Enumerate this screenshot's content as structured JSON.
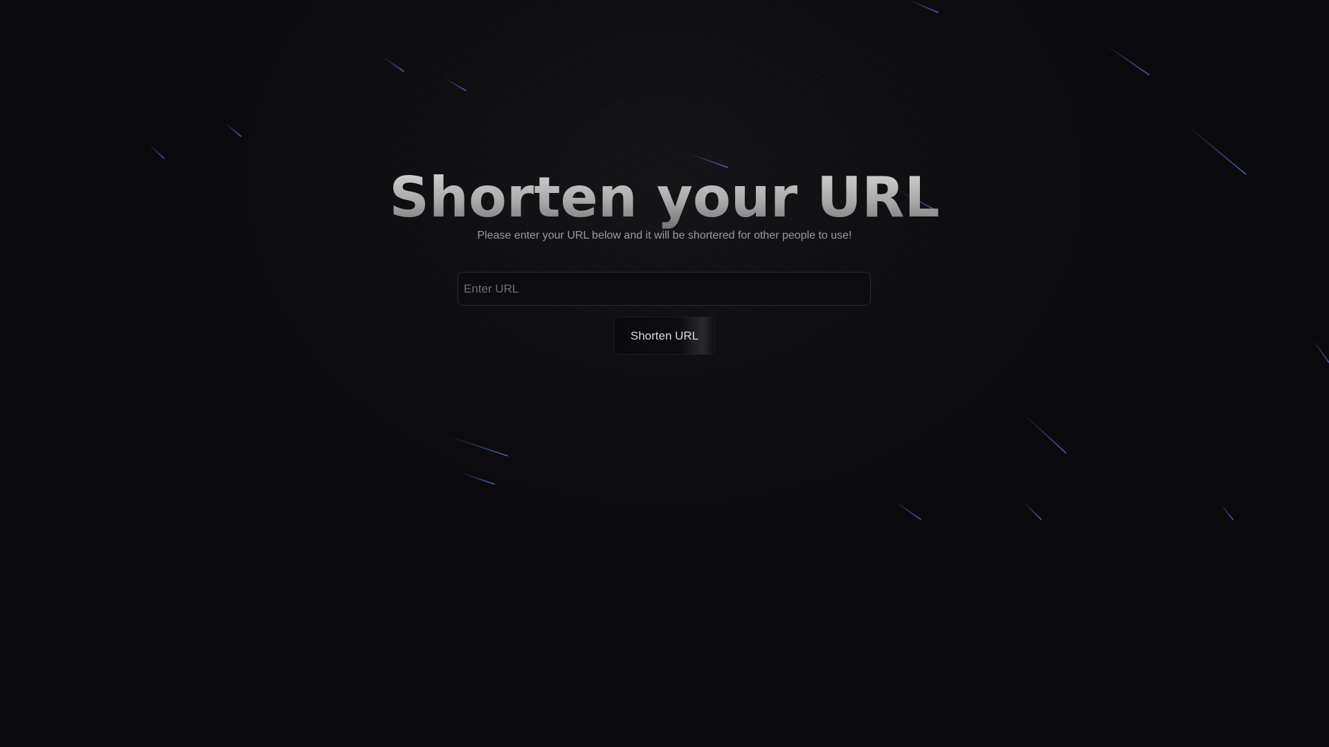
{
  "hero": {
    "title": "Shorten your URL",
    "subtitle": "Please enter your URL below and it will be shortered for other people to use!"
  },
  "form": {
    "url_placeholder": "Enter URL",
    "url_value": "",
    "submit_label": "Shorten URL"
  },
  "colors": {
    "background": "#0b0b0d",
    "streak": "#4a5ad8",
    "title_top": "#d9d9d9",
    "title_bottom": "#6f6f6f"
  }
}
